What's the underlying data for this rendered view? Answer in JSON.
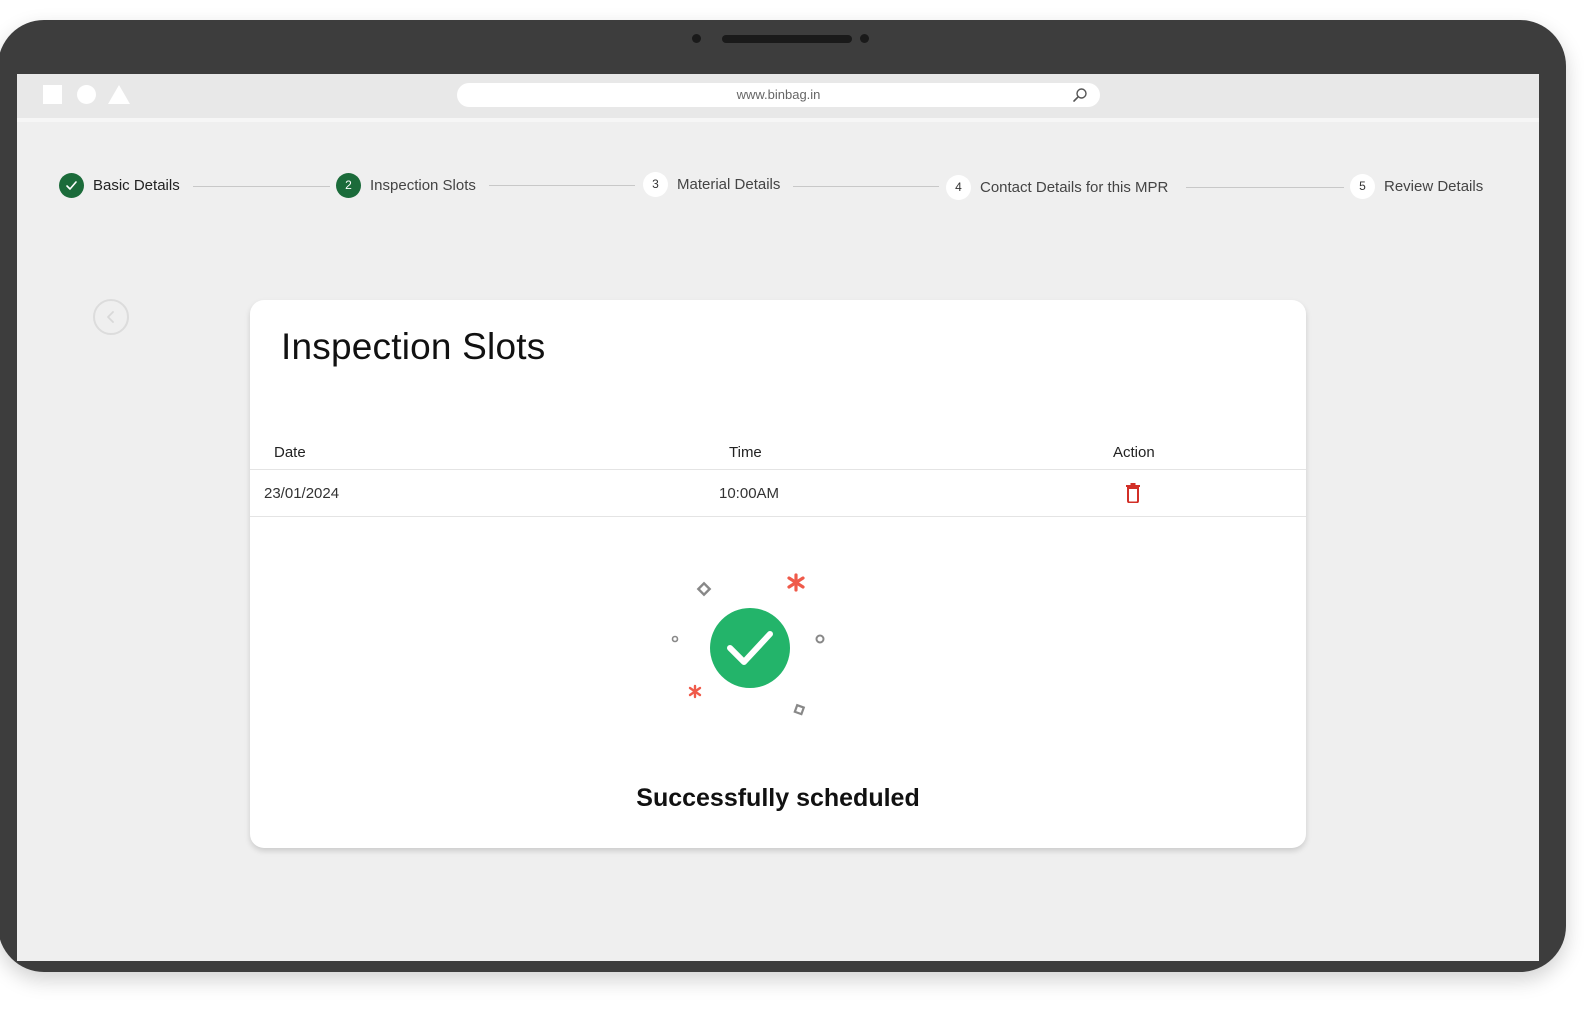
{
  "browser": {
    "url": "www.binbag.in"
  },
  "stepper": {
    "steps": [
      {
        "number": "",
        "label": "Basic Details",
        "state": "done"
      },
      {
        "number": "2",
        "label": "Inspection Slots",
        "state": "active"
      },
      {
        "number": "3",
        "label": "Material Details",
        "state": "pending"
      },
      {
        "number": "4",
        "label": "Contact Details for this MPR",
        "state": "pending"
      },
      {
        "number": "5",
        "label": "Review Details",
        "state": "pending"
      }
    ]
  },
  "card": {
    "title": "Inspection Slots",
    "table": {
      "headers": {
        "date": "Date",
        "time": "Time",
        "action": "Action"
      },
      "rows": [
        {
          "date": "23/01/2024",
          "time": "10:00AM",
          "action_icon": "trash-icon"
        }
      ]
    },
    "success_message": "Successfully scheduled"
  },
  "colors": {
    "brand_green": "#1b6b3a",
    "success_green": "#23b46a",
    "danger_red": "#d22f27",
    "accent_coral": "#ef5a4a"
  }
}
